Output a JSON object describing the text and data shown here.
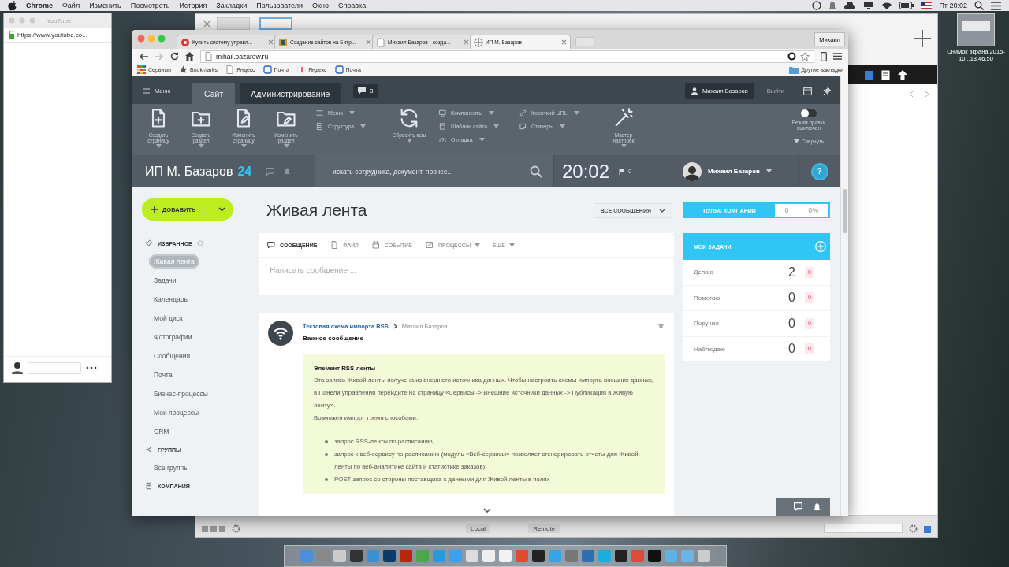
{
  "menubar": {
    "app": "Chrome",
    "items": [
      "Файл",
      "Изменить",
      "Посмотреть",
      "История",
      "Закладки",
      "Пользователи",
      "Окно",
      "Справка"
    ],
    "clock": "Пт 20:02"
  },
  "youtube_window": {
    "title": "YouTube",
    "url": "https://www.youtube.co..."
  },
  "back_window": {
    "bottom_bar": [
      "Local",
      "Remote"
    ]
  },
  "desktop_file": {
    "label": "Снимок экрана 2015-10...18.46.50"
  },
  "browser": {
    "tabs": [
      {
        "title": "Купить систему управл...",
        "selected": false
      },
      {
        "title": "Создание сайтов на Битр...",
        "selected": false
      },
      {
        "title": "Михаил Базаров - созда...",
        "selected": false
      },
      {
        "title": "ИП М. Базаров",
        "selected": true
      }
    ],
    "profile": "Михаил",
    "url": "mihail.bazarow.ru",
    "bookmarks": [
      {
        "kind": "apps",
        "label": "Сервисы"
      },
      {
        "kind": "star",
        "label": "Bookmarks"
      },
      {
        "kind": "page",
        "label": "Яндекс"
      },
      {
        "kind": "mail",
        "label": "Почта"
      },
      {
        "kind": "yandex",
        "label": "Яндекс"
      },
      {
        "kind": "mail",
        "label": "Почта"
      }
    ],
    "other_bookmarks": "Другие закладки"
  },
  "admin_panel": {
    "menu": "Меню",
    "tabs": [
      {
        "label": "Сайт",
        "selected": true
      },
      {
        "label": "Администрирование",
        "selected": false
      }
    ],
    "notifications": "3",
    "user": "Михаил Базаров",
    "logout": "Выйти",
    "tools": [
      {
        "kind": "large",
        "label": "Создать страницу"
      },
      {
        "kind": "large",
        "label": "Создать раздел"
      },
      {
        "kind": "large",
        "label": "Изменить страницу"
      },
      {
        "kind": "large",
        "label": "Изменить раздел"
      },
      {
        "kind": "list",
        "items": [
          "Меню",
          "Структура"
        ]
      },
      {
        "kind": "large",
        "label": "Сбросить кеш"
      },
      {
        "kind": "list",
        "items": [
          "Компоненты",
          "Шаблон сайта",
          "Отладка"
        ]
      },
      {
        "kind": "list",
        "items": [
          "Короткий URL",
          "Стикеры"
        ]
      },
      {
        "kind": "large",
        "label": "Мастер настроек"
      }
    ],
    "edit_mode": {
      "label": "Режим правки выключен",
      "on": false
    },
    "collapse": "Свернуть"
  },
  "header": {
    "company": "ИП М. Базаров",
    "company_badge": "24",
    "search_placeholder": "искать сотрудника, документ, прочее...",
    "time": "20:02",
    "flag_count": "0",
    "user": "Михаил Базаров",
    "help": "?"
  },
  "sidebar": {
    "add_button": "ДОБАВИТЬ",
    "sections": [
      {
        "title": "ИЗБРАННОЕ",
        "items": [
          {
            "label": "Живая лента",
            "selected": true
          },
          {
            "label": "Задачи",
            "selected": false
          },
          {
            "label": "Календарь",
            "selected": false
          },
          {
            "label": "Мой диск",
            "selected": false
          },
          {
            "label": "Фотографии",
            "selected": false
          },
          {
            "label": "Сообщения",
            "selected": false
          },
          {
            "label": "Почта",
            "selected": false
          },
          {
            "label": "Бизнес-процессы",
            "selected": false
          },
          {
            "label": "Мои процессы",
            "selected": false
          },
          {
            "label": "CRM",
            "selected": false
          }
        ]
      },
      {
        "title": "ГРУППЫ",
        "items": [
          {
            "label": "Все группы",
            "selected": false
          }
        ]
      },
      {
        "title": "КОМПАНИЯ"
      }
    ]
  },
  "feed": {
    "title": "Живая лента",
    "filter": "ВСЕ СООБЩЕНИЯ",
    "composer": {
      "tabs": [
        {
          "label": "СООБЩЕНИЕ",
          "selected": true
        },
        {
          "label": "ФАЙЛ",
          "selected": false
        },
        {
          "label": "СОБЫТИЕ",
          "selected": false
        },
        {
          "label": "ПРОЦЕССЫ",
          "selected": false
        },
        {
          "label": "ЕЩЕ",
          "selected": false
        }
      ],
      "placeholder": "Написать сообщение ..."
    },
    "post": {
      "author": "Тестовая схема импорта RSS",
      "recipient": "Михаил Базаров",
      "title": "Важное сообщение",
      "box_title": "Элемент RSS-ленты",
      "paragraphs": [
        "Эта запись Живой ленты получена из внешнего источника данных. Чтобы настроить схемы импорта внешних данных, в Панели управления перейдите на страницу «Сервисы -> Внешние источники данных -> Публикация в Живую ленту».",
        "Возможен импорт тремя способами:"
      ],
      "list": [
        "запрос RSS-ленты по расписанию,",
        "запрос к веб-сервису по расписанию (модуль «Веб-сервисы» позволяет сгенерировать отчеты для Живой ленты по веб-аналитике сайта и статистике заказов),",
        "POST-запрос со стороны поставщика с данными для Живой ленты в полях"
      ]
    }
  },
  "pulse": {
    "label": "ПУЛЬС КОМПАНИИ",
    "value": "0",
    "percent": "0%"
  },
  "tasks": {
    "title": "МОИ ЗАДАЧИ",
    "rows": [
      {
        "label": "Делаю",
        "count": "2",
        "overdue": "0"
      },
      {
        "label": "Помогаю",
        "count": "0",
        "overdue": "0"
      },
      {
        "label": "Поручил",
        "count": "0",
        "overdue": "0"
      },
      {
        "label": "Наблюдаю",
        "count": "0",
        "overdue": "0"
      }
    ]
  }
}
